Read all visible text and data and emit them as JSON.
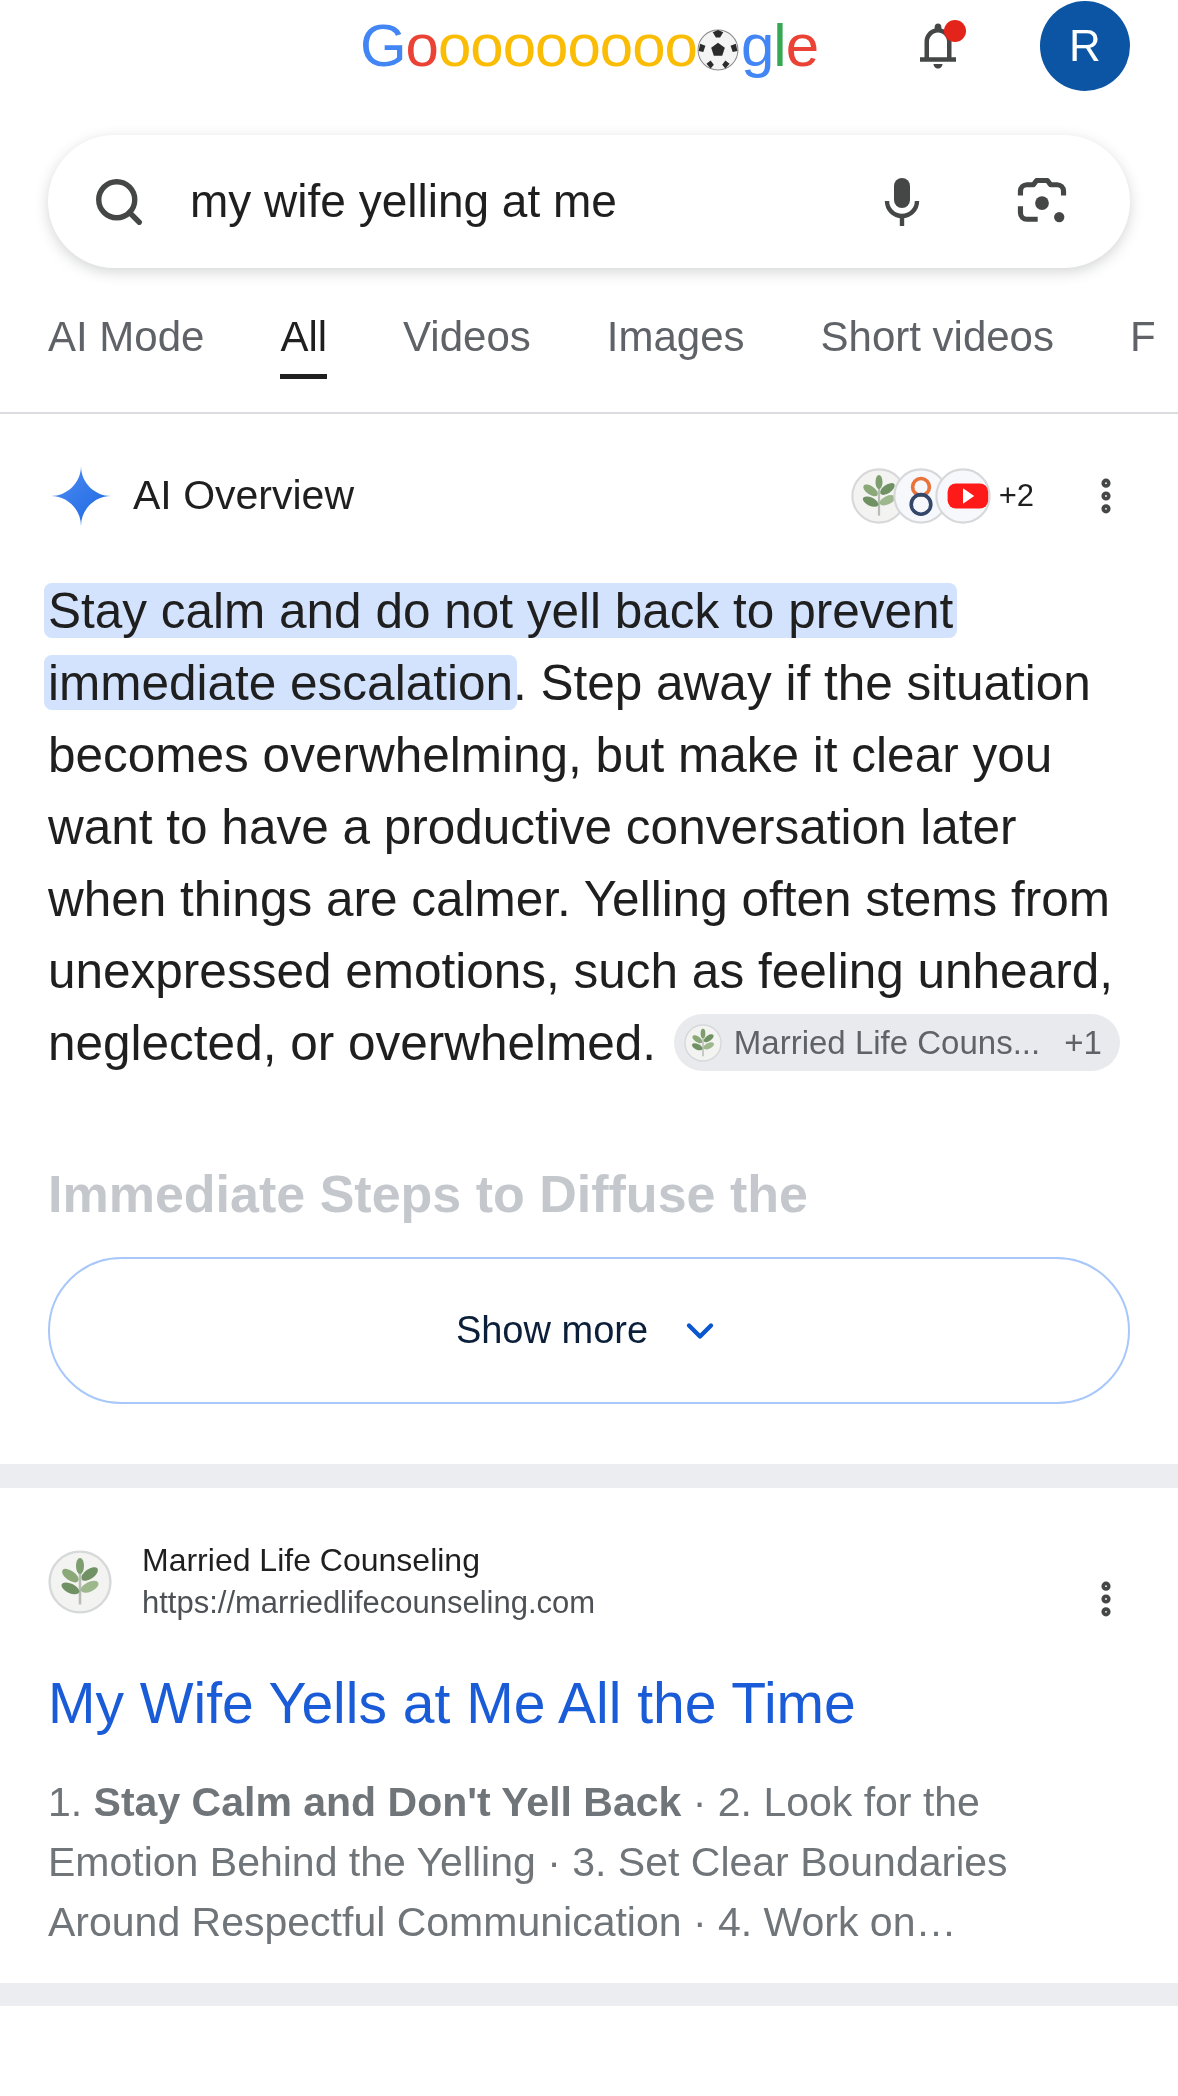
{
  "header": {
    "logo": {
      "before_ball": "Gooooooooo",
      "after_ball": "gle"
    },
    "notifications": {
      "unread": true
    },
    "avatar": {
      "initial": "R"
    }
  },
  "search": {
    "query": "my wife yelling at me"
  },
  "tabs": [
    {
      "label": "AI Mode",
      "selected": false
    },
    {
      "label": "All",
      "selected": true
    },
    {
      "label": "Videos",
      "selected": false
    },
    {
      "label": "Images",
      "selected": false
    },
    {
      "label": "Short videos",
      "selected": false
    },
    {
      "label": "F",
      "selected": false
    }
  ],
  "ai_overview": {
    "title": "AI Overview",
    "sources": {
      "icons": [
        {
          "kind": "leaf"
        },
        {
          "kind": "eight"
        },
        {
          "kind": "play"
        }
      ],
      "more": "+2"
    },
    "highlight": "Stay calm and do not yell back to prevent immediate escalation",
    "text": ". Step away if the situation becomes overwhelming, but make it clear you want to have a productive conversation later when things are calmer. Yelling often stems from unexpressed emotions, such as feeling unheard, neglected, or overwhelmed.",
    "citation": {
      "label": "Married Life Couns...",
      "more": "+1"
    },
    "faded_heading": "Immediate Steps to Diffuse the",
    "show_more": "Show more"
  },
  "results": [
    {
      "site": "Married Life Counseling",
      "url": "https://marriedlifecounseling.com",
      "title": "My Wife Yells at Me All the Time",
      "snippet": "1. **Stay Calm and Don't Yell Back** · 2. Look for the Emotion Behind the Yelling · 3. Set Clear Boundaries Around Respectful Communication · 4. Work on…"
    }
  ]
}
